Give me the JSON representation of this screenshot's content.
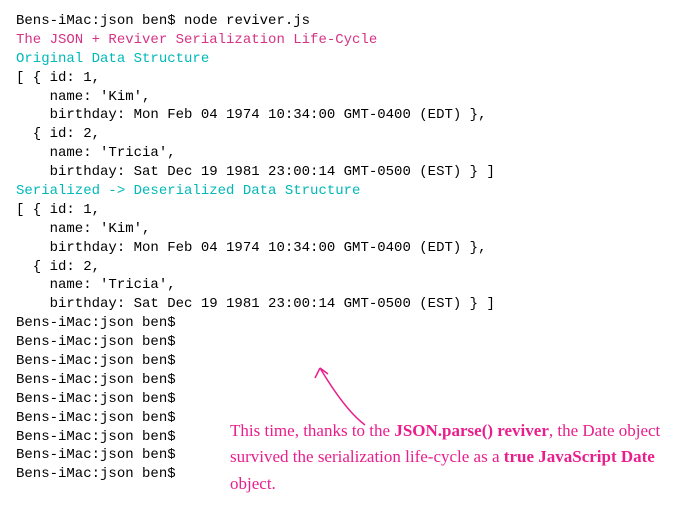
{
  "terminal": {
    "prompt": "Bens-iMac:json ben$",
    "command": "node reviver.js",
    "title_line": "The JSON + Reviver Serialization Life-Cycle",
    "section1_header": "Original Data Structure",
    "section2_header": "Serialized -> Deserialized Data Structure",
    "data_lines": {
      "l1": "[ { id: 1,",
      "l2": "    name: 'Kim',",
      "l3": "    birthday: Mon Feb 04 1974 10:34:00 GMT-0400 (EDT) },",
      "l4": "  { id: 2,",
      "l5": "    name: 'Tricia',",
      "l6": "    birthday: Sat Dec 19 1981 23:00:14 GMT-0500 (EST) } ]"
    }
  },
  "annotation": {
    "part1": "This time, thanks to the ",
    "bold1": "JSON.parse() reviver",
    "part2": ", the Date object survived the serialization life-cycle as a ",
    "bold2": "true JavaScript Date",
    "part3": " object."
  },
  "colors": {
    "magenta": "#d63384",
    "cyan": "#00b8b8",
    "annotation": "#e91e8c",
    "text": "#000000",
    "bg": "#ffffff"
  }
}
